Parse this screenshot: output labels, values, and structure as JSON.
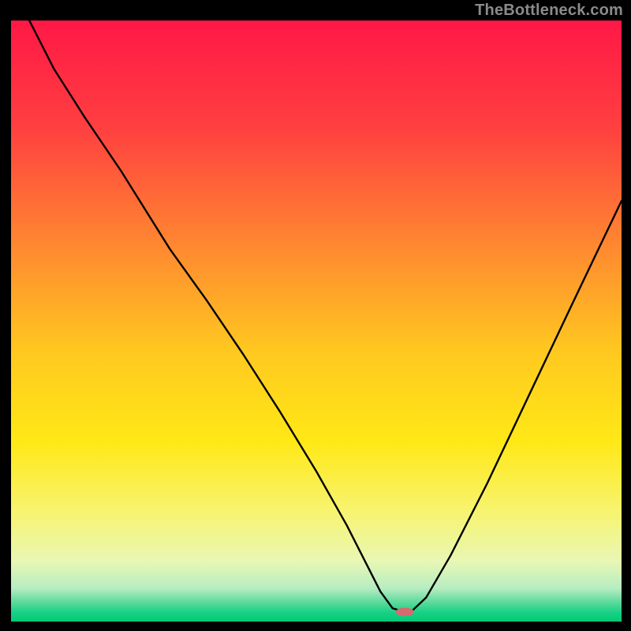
{
  "watermark": "TheBottleneck.com",
  "chart_data": {
    "type": "line",
    "title": "",
    "xlabel": "",
    "ylabel": "",
    "xlim": [
      0,
      100
    ],
    "ylim": [
      0,
      100
    ],
    "grid": false,
    "legend": false,
    "background": {
      "type": "vertical-gradient",
      "stops": [
        {
          "pos": 0.0,
          "color": "#ff1846"
        },
        {
          "pos": 0.18,
          "color": "#ff4040"
        },
        {
          "pos": 0.38,
          "color": "#ff8a30"
        },
        {
          "pos": 0.55,
          "color": "#ffc820"
        },
        {
          "pos": 0.7,
          "color": "#ffe816"
        },
        {
          "pos": 0.82,
          "color": "#f7f472"
        },
        {
          "pos": 0.9,
          "color": "#e8f7b4"
        },
        {
          "pos": 0.945,
          "color": "#b6edc2"
        },
        {
          "pos": 0.965,
          "color": "#68dca0"
        },
        {
          "pos": 0.985,
          "color": "#18d184"
        },
        {
          "pos": 1.0,
          "color": "#03c977"
        }
      ]
    },
    "series": [
      {
        "name": "bottleneck-curve",
        "x": [
          3,
          7,
          12,
          18,
          26,
          32,
          38,
          44,
          50,
          55,
          58.5,
          60.5,
          62.5,
          64.5,
          65.5,
          68,
          72,
          78,
          85,
          92,
          100
        ],
        "y": [
          100,
          92,
          84,
          75,
          62,
          53.5,
          44.5,
          35,
          25,
          16,
          9,
          5,
          2.2,
          1.6,
          1.6,
          4,
          11,
          23,
          38,
          53,
          70
        ]
      }
    ],
    "marker": {
      "name": "optimal-point",
      "x": 64.5,
      "y": 1.6,
      "color": "#d66a6f",
      "rx": 1.5,
      "ry": 0.7
    }
  }
}
